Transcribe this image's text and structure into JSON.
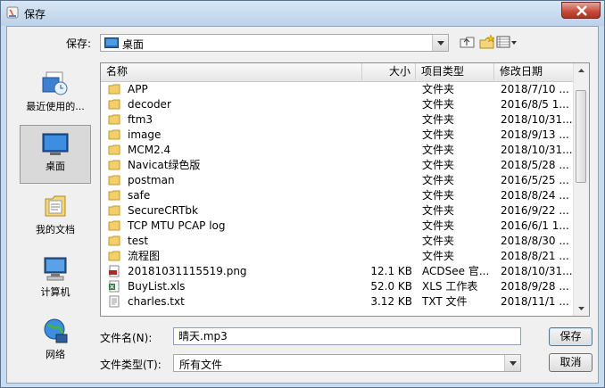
{
  "window": {
    "title": "保存"
  },
  "toolbar": {
    "save_in_label": "保存:",
    "location": "桌面"
  },
  "places": [
    {
      "label": "最近使用的...",
      "icon": "recent-icon"
    },
    {
      "label": "桌面",
      "icon": "desktop-icon"
    },
    {
      "label": "我的文档",
      "icon": "documents-icon"
    },
    {
      "label": "计算机",
      "icon": "computer-icon"
    },
    {
      "label": "网络",
      "icon": "network-icon"
    }
  ],
  "columns": {
    "name": "名称",
    "size": "大小",
    "type": "项目类型",
    "date": "修改日期"
  },
  "files": [
    {
      "name": "APP",
      "size": "",
      "type": "文件夹",
      "date": "2018/7/10 ...",
      "kind": "folder"
    },
    {
      "name": "decoder",
      "size": "",
      "type": "文件夹",
      "date": "2016/8/5 1...",
      "kind": "folder"
    },
    {
      "name": "ftm3",
      "size": "",
      "type": "文件夹",
      "date": "2018/10/31...",
      "kind": "folder"
    },
    {
      "name": "image",
      "size": "",
      "type": "文件夹",
      "date": "2018/9/13 ...",
      "kind": "folder"
    },
    {
      "name": "MCM2.4",
      "size": "",
      "type": "文件夹",
      "date": "2018/10/31...",
      "kind": "folder"
    },
    {
      "name": "Navicat绿色版",
      "size": "",
      "type": "文件夹",
      "date": "2018/5/28 ...",
      "kind": "folder"
    },
    {
      "name": "postman",
      "size": "",
      "type": "文件夹",
      "date": "2016/5/25 ...",
      "kind": "folder"
    },
    {
      "name": "safe",
      "size": "",
      "type": "文件夹",
      "date": "2018/8/24 ...",
      "kind": "folder"
    },
    {
      "name": "SecureCRTbk",
      "size": "",
      "type": "文件夹",
      "date": "2016/9/22 ...",
      "kind": "folder"
    },
    {
      "name": "TCP MTU PCAP log",
      "size": "",
      "type": "文件夹",
      "date": "2016/6/1 1...",
      "kind": "folder"
    },
    {
      "name": "test",
      "size": "",
      "type": "文件夹",
      "date": "2018/8/30 ...",
      "kind": "folder"
    },
    {
      "name": "流程图",
      "size": "",
      "type": "文件夹",
      "date": "2018/8/21 ...",
      "kind": "folder"
    },
    {
      "name": "20181031115519.png",
      "size": "12.1 KB",
      "type": "ACDSee 官...",
      "date": "2018/10/31...",
      "kind": "png"
    },
    {
      "name": "BuyList.xls",
      "size": "52.0 KB",
      "type": "XLS 工作表",
      "date": "2018/9/28 ...",
      "kind": "xls"
    },
    {
      "name": "charles.txt",
      "size": "3.12 KB",
      "type": "TXT 文件",
      "date": "2018/11/1 ...",
      "kind": "txt"
    }
  ],
  "bottom": {
    "filename_label": "文件名(N):",
    "filename_value": "晴天.mp3",
    "filetype_label": "文件类型(T):",
    "filetype_value": "所有文件",
    "save_button": "保存",
    "cancel_button": "取消"
  }
}
